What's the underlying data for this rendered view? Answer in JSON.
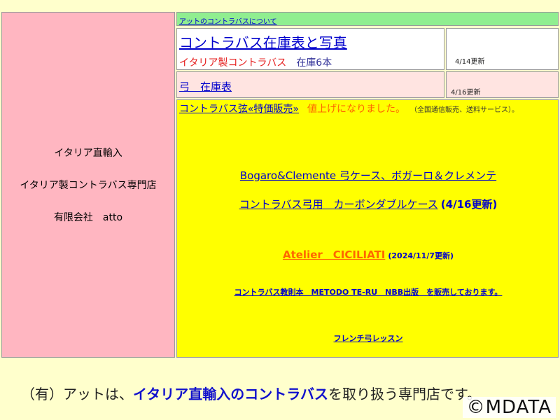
{
  "left_panel": {
    "line1": "イタリア直輸入",
    "line2": "イタリア製コントラバス専門店",
    "line3": "有限会社　atto"
  },
  "about_link": "アットのコントラバスについて",
  "stock": {
    "title": "コントラバス在庫表と写真",
    "sub": "イタリア製コントラバス",
    "count": "在庫6本",
    "date": "4/14更新"
  },
  "bow": {
    "label": "弓　在庫表",
    "date": "4/16更新"
  },
  "main": {
    "strings_link": "コントラバス弦«特価販売»",
    "price_up": "値上げになりました。",
    "strings_note": "（全国通信販売、送料サービス）。",
    "bogaro": "Bogaro&Clemente 弓ケース、ボガーロ＆クレメンテ",
    "carbon": "コントラバス弓用　カーボンダブルケース",
    "carbon_update": "(4/16更新)",
    "atelier": "Atelier　CICILIATI",
    "atelier_update": "(2024/11/7更新)",
    "metodo": "コントラバス教則本　METODO TE-RU　NBB出版　を販売しております。",
    "french": "フレンチ弓レッスン"
  },
  "footer": {
    "pre": "（有）アットは、",
    "highlight": "イタリア直輸入のコントラバス",
    "post": "を取り扱う専門店です。"
  },
  "watermark": "©MDATA",
  "colors": {
    "background": "#ffffcc",
    "left_panel": "#ffb6c1",
    "about_cell": "#90ee90",
    "main_cell": "#ffff00",
    "link": "#0000cc",
    "accent_orange": "#ff6600",
    "accent_red": "#e62020"
  }
}
